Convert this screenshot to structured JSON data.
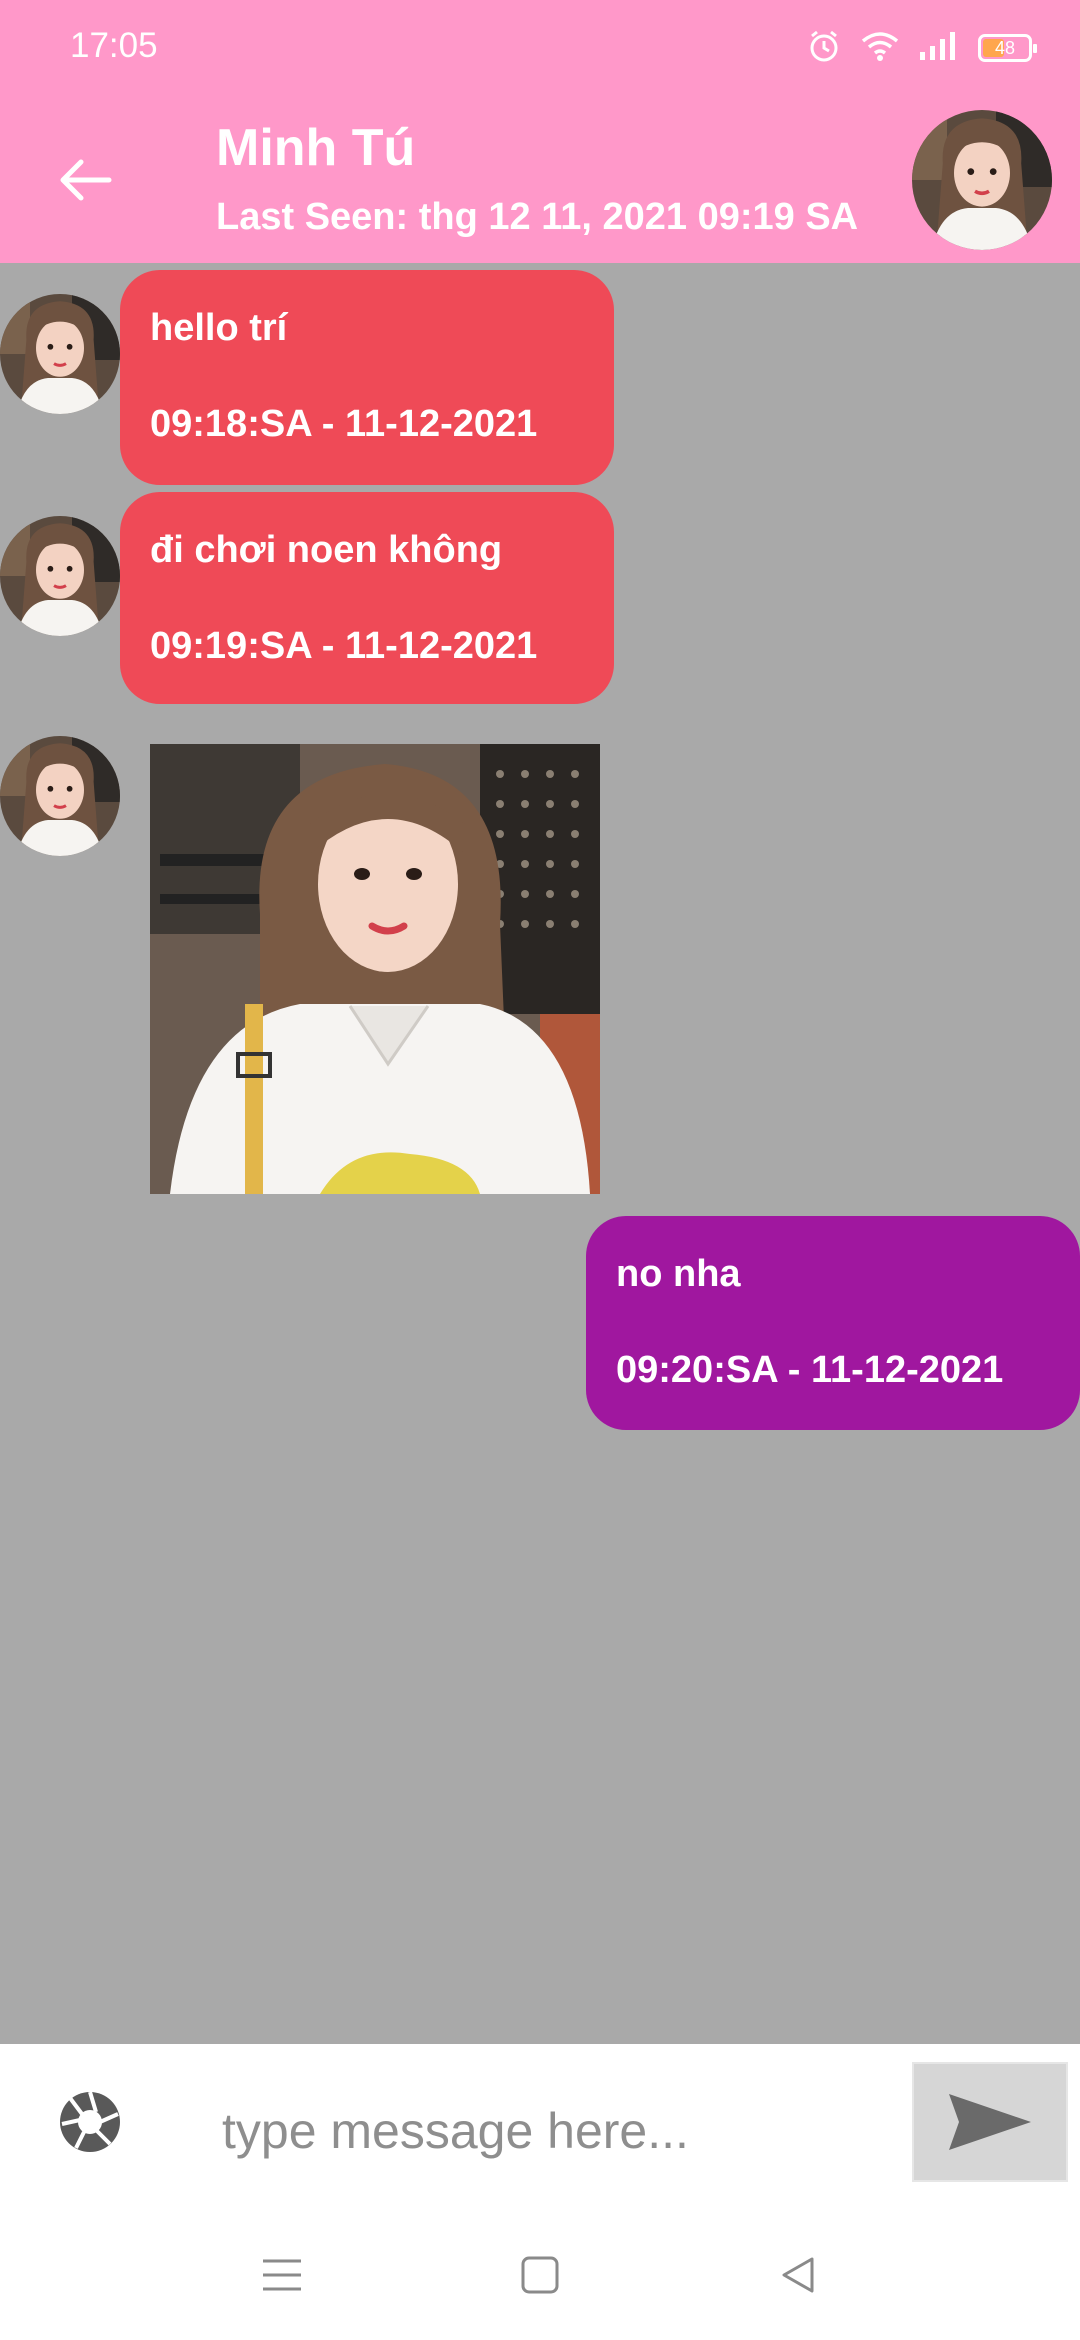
{
  "status_bar": {
    "time": "17:05",
    "battery_level": "48",
    "icons": [
      "alarm-icon",
      "wifi-icon",
      "signal-icon",
      "battery-icon"
    ]
  },
  "header": {
    "back_icon": "arrow-left-icon",
    "contact_name": "Minh Tú",
    "last_seen": "Last Seen: thg 12 11, 2021 09:19 SA"
  },
  "messages": [
    {
      "direction": "incoming",
      "type": "text",
      "text": "hello trí",
      "time": "09:18:SA - 11-12-2021"
    },
    {
      "direction": "incoming",
      "type": "text",
      "text": "đi chơi noen không",
      "time": "09:19:SA - 11-12-2021"
    },
    {
      "direction": "incoming",
      "type": "image"
    },
    {
      "direction": "outgoing",
      "type": "text",
      "text": "no nha",
      "time": "09:20:SA - 11-12-2021"
    }
  ],
  "composer": {
    "placeholder": "type message here...",
    "camera_icon": "camera-icon",
    "send_icon": "send-icon"
  },
  "nav_bar": [
    "menu-icon",
    "home-icon",
    "back-triangle-icon"
  ],
  "colors": {
    "header": "#ff98c9",
    "chat_background": "#a9a9a9",
    "incoming_bubble": "#ef4a57",
    "outgoing_bubble": "#a0179f",
    "send_button": "#d6d6d6"
  }
}
